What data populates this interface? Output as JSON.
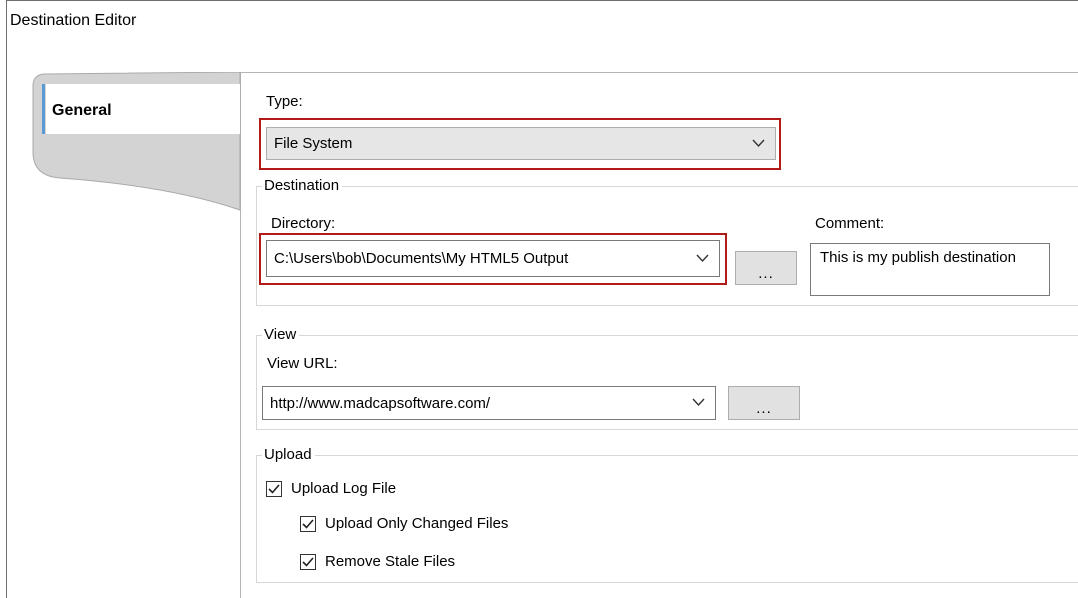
{
  "window": {
    "title": "Destination Editor"
  },
  "tabs": [
    {
      "label": "General"
    }
  ],
  "type": {
    "label": "Type:",
    "value": "File System"
  },
  "destination": {
    "group_title": "Destination",
    "directory_label": "Directory:",
    "directory_value": "C:\\Users\\bob\\Documents\\My HTML5 Output",
    "browse_label": "...",
    "comment_label": "Comment:",
    "comment_value": "This is my publish destination"
  },
  "view": {
    "group_title": "View",
    "url_label": "View URL:",
    "url_value": "http://www.madcapsoftware.com/",
    "browse_label": "..."
  },
  "upload": {
    "group_title": "Upload",
    "options": [
      {
        "label": "Upload Log File",
        "checked": true
      },
      {
        "label": "Upload Only Changed Files",
        "checked": true
      },
      {
        "label": "Remove Stale Files",
        "checked": true
      }
    ]
  },
  "colors": {
    "highlight": "#b31b1b",
    "dropdown_bg": "#e6e6e6",
    "button_bg": "#e1e1e1"
  }
}
